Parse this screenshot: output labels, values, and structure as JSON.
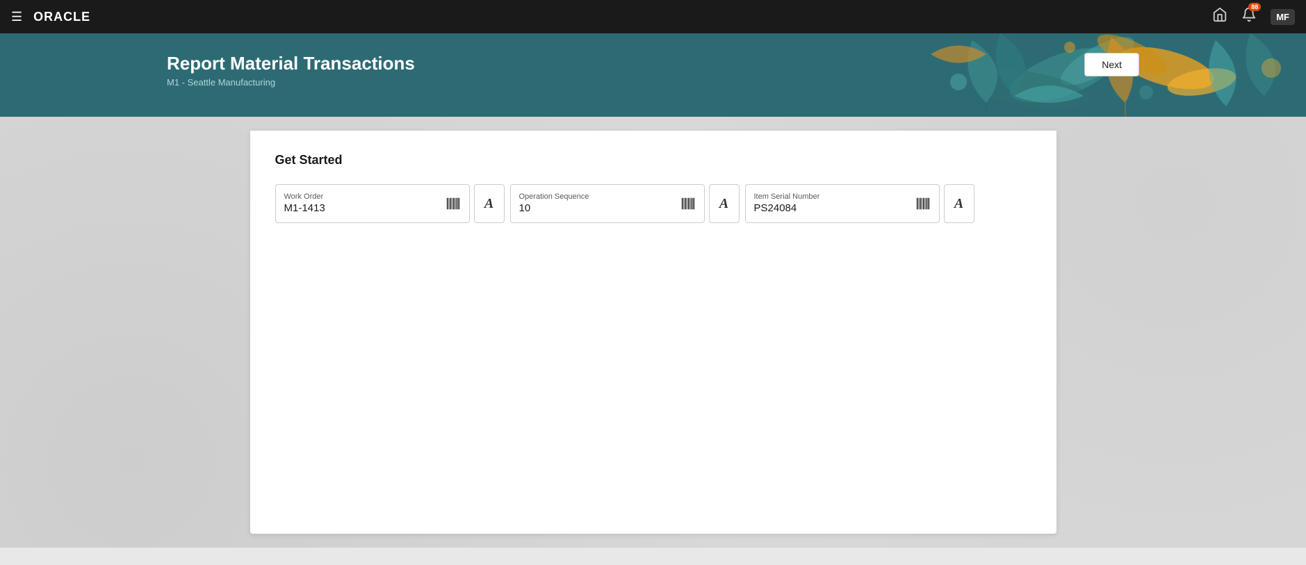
{
  "navbar": {
    "hamburger_label": "☰",
    "logo": "ORACLE",
    "home_icon": "🏠",
    "bell_icon": "🔔",
    "bell_badge": "88",
    "avatar_text": "MF"
  },
  "header": {
    "title": "Report Material Transactions",
    "subtitle": "M1 - Seattle Manufacturing",
    "next_button_label": "Next"
  },
  "main": {
    "section_title": "Get Started",
    "fields": [
      {
        "label": "Work Order",
        "value": "M1-1413",
        "name": "work-order-field"
      },
      {
        "label": "Operation Sequence",
        "value": "10",
        "name": "operation-sequence-field"
      },
      {
        "label": "Item Serial Number",
        "value": "PS24084",
        "name": "item-serial-number-field"
      }
    ]
  }
}
